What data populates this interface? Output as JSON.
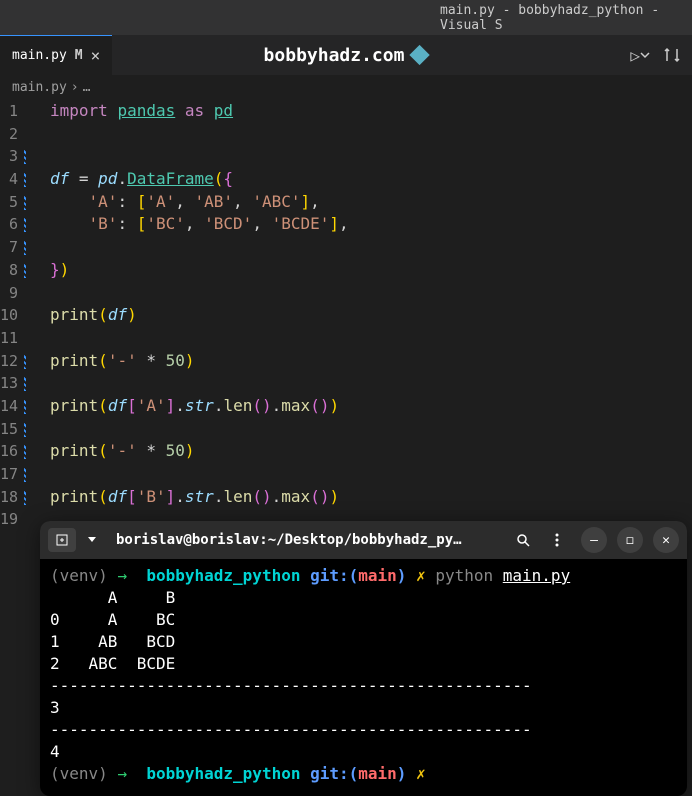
{
  "titlebar": "main.py - bobbyhadz_python - Visual S",
  "tab": {
    "label": "main.py",
    "modified": "M",
    "close": "×"
  },
  "banner": "bobbyhadz.com",
  "breadcrumb": {
    "file": "main.py",
    "sep": "›",
    "more": "…"
  },
  "runAction": "▷",
  "code": {
    "lines": [
      "1",
      "2",
      "3",
      "4",
      "5",
      "6",
      "7",
      "8",
      "9",
      "10",
      "11",
      "12",
      "13",
      "14",
      "15",
      "16",
      "17",
      "18",
      "19"
    ],
    "l1": {
      "import": "import",
      "pandas": "pandas",
      "as": "as",
      "pd": "pd"
    },
    "l4": {
      "df": "df",
      "eq": " = ",
      "pd": "pd",
      "dot": ".",
      "cls": "DataFrame",
      "op": "(",
      "br": "{"
    },
    "l5": {
      "key": "'A'",
      "col": ": ",
      "br": "[",
      "v1": "'A'",
      "c": ", ",
      "v2": "'AB'",
      "v3": "'ABC'",
      "cb": "]",
      "cm": ","
    },
    "l6": {
      "key": "'B'",
      "col": ": ",
      "br": "[",
      "v1": "'BC'",
      "c": ", ",
      "v2": "'BCD'",
      "v3": "'BCDE'",
      "cb": "]",
      "cm": ","
    },
    "l8": {
      "br": "}",
      "pn": ")"
    },
    "l10": {
      "print": "print",
      "op": "(",
      "df": "df",
      "cp": ")"
    },
    "l12": {
      "print": "print",
      "op": "(",
      "str": "'-'",
      "star": " * ",
      "num": "50",
      "cp": ")"
    },
    "l14": {
      "print": "print",
      "op": "(",
      "df": "df",
      "br": "[",
      "key": "'A'",
      "cb": "]",
      "dot": ".",
      "str": "str",
      "len": "len",
      "pn2o": "(",
      "pn2c": ")",
      "max": "max",
      "cp": ")"
    },
    "l16": {
      "print": "print",
      "op": "(",
      "str": "'-'",
      "star": " * ",
      "num": "50",
      "cp": ")"
    },
    "l18": {
      "print": "print",
      "op": "(",
      "df": "df",
      "br": "[",
      "key": "'B'",
      "cb": "]",
      "dot": ".",
      "str": "str",
      "len": "len",
      "pn2o": "(",
      "pn2c": ")",
      "max": "max",
      "cp": ")"
    }
  },
  "terminal": {
    "title": "borislav@borislav:~/Desktop/bobbyhadz_py…",
    "p1": {
      "venv": "(venv) ",
      "arrow": "→  ",
      "dir": "bobbyhadz_python",
      "git": " git:(",
      "branch": "main",
      "gitc": ") ",
      "x": "✗ ",
      "cmd": "python ",
      "file": "main.py"
    },
    "out": {
      "h": "      A     B",
      "r0": "0     A    BC",
      "r1": "1    AB   BCD",
      "r2": "2   ABC  BCDE",
      "sep": "--------------------------------------------------",
      "v3": "3",
      "v4": "4"
    },
    "p2": {
      "venv": "(venv) ",
      "arrow": "→  ",
      "dir": "bobbyhadz_python",
      "git": " git:(",
      "branch": "main",
      "gitc": ") ",
      "x": "✗"
    }
  }
}
